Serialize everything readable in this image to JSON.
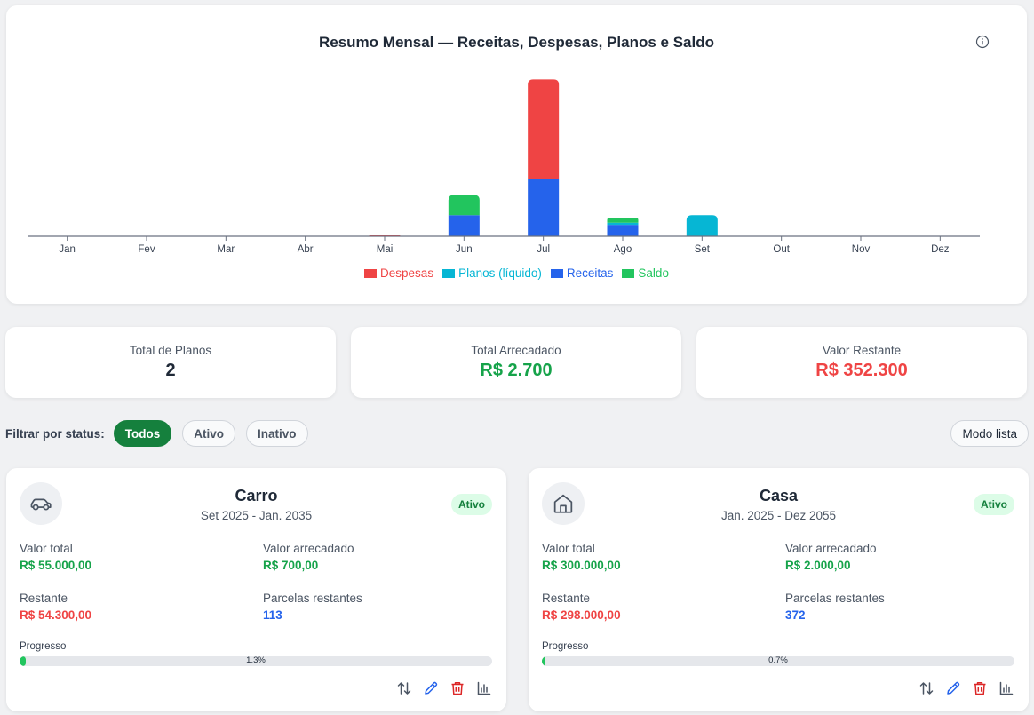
{
  "chart_data": {
    "type": "bar",
    "stacked": true,
    "title": "Resumo Mensal — Receitas, Despesas, Planos e Saldo",
    "categories": [
      "Jan",
      "Fev",
      "Mar",
      "Abr",
      "Mai",
      "Jun",
      "Jul",
      "Ago",
      "Set",
      "Out",
      "Nov",
      "Dez"
    ],
    "series": [
      {
        "name": "Receitas",
        "color": "#2563eb",
        "values": [
          0,
          0,
          0,
          0,
          0,
          700,
          1900,
          380,
          0,
          0,
          0,
          0
        ]
      },
      {
        "name": "Despesas",
        "color": "#ef4444",
        "values": [
          0,
          0,
          0,
          0,
          30,
          0,
          3300,
          0,
          0,
          0,
          0,
          0
        ]
      },
      {
        "name": "Planos (líquido)",
        "color": "#06b6d4",
        "values": [
          0,
          0,
          0,
          0,
          0,
          0,
          0,
          70,
          700,
          0,
          0,
          0
        ]
      },
      {
        "name": "Saldo",
        "color": "#22c55e",
        "values": [
          0,
          0,
          0,
          0,
          0,
          670,
          0,
          170,
          0,
          0,
          0,
          0
        ]
      }
    ],
    "legend": {
      "order": [
        "Despesas",
        "Planos (líquido)",
        "Receitas",
        "Saldo"
      ],
      "position": "bottom"
    },
    "ylim": [
      0,
      5300
    ],
    "grid": false
  },
  "stats": [
    {
      "label": "Total de Planos",
      "value": "2",
      "color": "#1f2937"
    },
    {
      "label": "Total Arrecadado",
      "value": "R$ 2.700",
      "color": "#16a34a"
    },
    {
      "label": "Valor Restante",
      "value": "R$ 352.300",
      "color": "#ef4444"
    }
  ],
  "filter": {
    "label": "Filtrar por status:",
    "options": [
      "Todos",
      "Ativo",
      "Inativo"
    ],
    "selected": "Todos",
    "mode_button": "Modo lista"
  },
  "labels": {
    "valor_total": "Valor total",
    "valor_arrecadado": "Valor arrecadado",
    "restante": "Restante",
    "parcelas_restantes": "Parcelas restantes",
    "progresso": "Progresso"
  },
  "plans": [
    {
      "icon": "car-icon",
      "name": "Carro",
      "period": "Set 2025 - Jan. 2035",
      "status": "Ativo",
      "valor_total": "R$ 55.000,00",
      "valor_arrecadado": "R$ 700,00",
      "restante": "R$ 54.300,00",
      "parcelas_restantes": "113",
      "progress": 1.3,
      "progress_text": "1.3%"
    },
    {
      "icon": "house-icon",
      "name": "Casa",
      "period": "Jan. 2025 - Dez 2055",
      "status": "Ativo",
      "valor_total": "R$ 300.000,00",
      "valor_arrecadado": "R$ 2.000,00",
      "restante": "R$ 298.000,00",
      "parcelas_restantes": "372",
      "progress": 0.7,
      "progress_text": "0.7%"
    }
  ]
}
